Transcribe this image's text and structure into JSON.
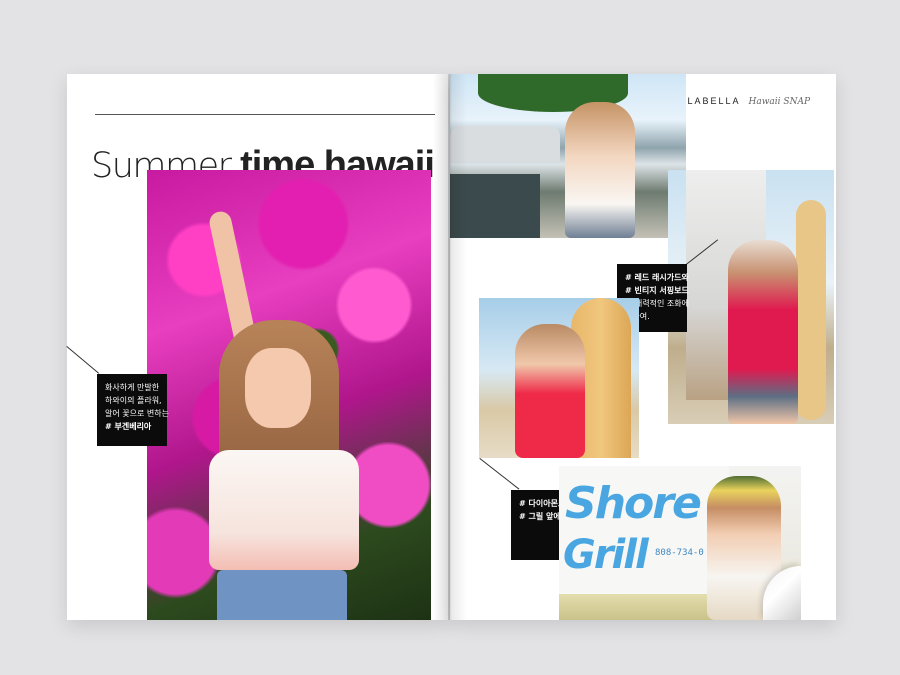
{
  "left_page": {
    "headline_light": "Summer",
    "headline_bold": "time hawaii",
    "caption": {
      "line1": "화사하게 만발한",
      "line2": "하와이의 플라워,",
      "line3": "알어 꽃으로 변하는",
      "tag": "# 부겐베리아"
    }
  },
  "right_page": {
    "brand_text": "LABELLA",
    "brand_script": "Hawaii SNAP",
    "caption1": {
      "line1": "# 레드 래시가드와",
      "line2": "# 빈티지 서핑보드",
      "line3": "그 매력적인 조화에",
      "line4": "대하여."
    },
    "caption2": {
      "line1": "# 다이아몬드 헤드",
      "line2": "# 그릴 앞에서"
    },
    "sign_text1": "Shore",
    "sign_text2": "Grill",
    "sign_phone": "808-734-0"
  },
  "colors": {
    "background": "#e3e3e5",
    "caption_box": "#0b0b0b",
    "bougainvillea": "#e21fb0",
    "rashguard": "#e0194f"
  }
}
